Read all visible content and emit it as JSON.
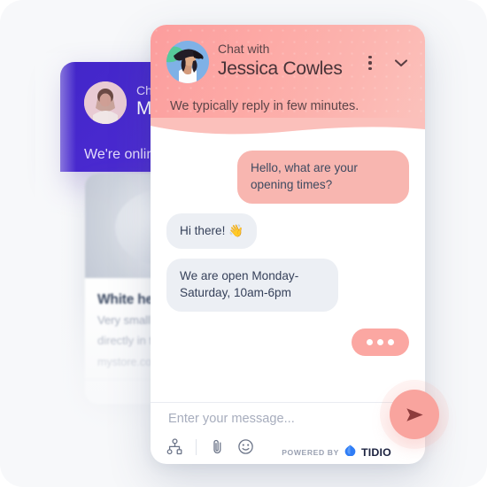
{
  "page": {
    "background_color": "#f7f8fa"
  },
  "background_cards": {
    "purple_card": {
      "title_small": "Chat with",
      "title_large": "Mi",
      "status": "We're online",
      "avatar_icon": "woman-avatar",
      "color": "#4a2ad0"
    },
    "product_card": {
      "title": "White headphones",
      "description_line1": "Very small an",
      "description_line2": "directly in the",
      "url": "mystore.com",
      "image_icon": "headphones-product-image"
    }
  },
  "widget": {
    "header": {
      "avatar_icon": "agent-avatar",
      "subtitle": "Chat with",
      "agent_name": "Jessica Cowles",
      "tagline": "We typically reply in few minutes.",
      "menu_icon": "kebab-menu-icon",
      "minimize_icon": "chevron-down-icon",
      "gradient_start": "#fc9d9d",
      "gradient_end": "#fbc3bd"
    },
    "messages": [
      {
        "id": "m1",
        "direction": "out",
        "text": "Hello, what are your opening times?",
        "bubble_color": "#f8b6b0"
      },
      {
        "id": "m2",
        "direction": "in",
        "text": "Hi there! 👋",
        "bubble_color": "#eceff4"
      },
      {
        "id": "m3",
        "direction": "in",
        "text": "We are open Monday-Saturday, 10am-6pm",
        "bubble_color": "#eceff4"
      }
    ],
    "typing_indicator": {
      "visible": true,
      "color": "#fba7a2",
      "dots": 3
    },
    "footer": {
      "input_placeholder": "Enter your message...",
      "input_value": "",
      "icons": [
        {
          "name": "flow-chart-icon",
          "label": "Flows"
        },
        {
          "name": "paperclip-icon",
          "label": "Attach file"
        },
        {
          "name": "emoji-smiley-icon",
          "label": "Emoji"
        }
      ],
      "powered_by_label": "POWERED BY",
      "brand_name": "TIDIO",
      "brand_icon": "tidio-droplet-logo",
      "brand_color": "#2f7df6"
    },
    "send_button": {
      "icon": "send-paper-plane-icon",
      "color": "#f9a49e",
      "arrow_color": "#8e3c3c"
    }
  }
}
